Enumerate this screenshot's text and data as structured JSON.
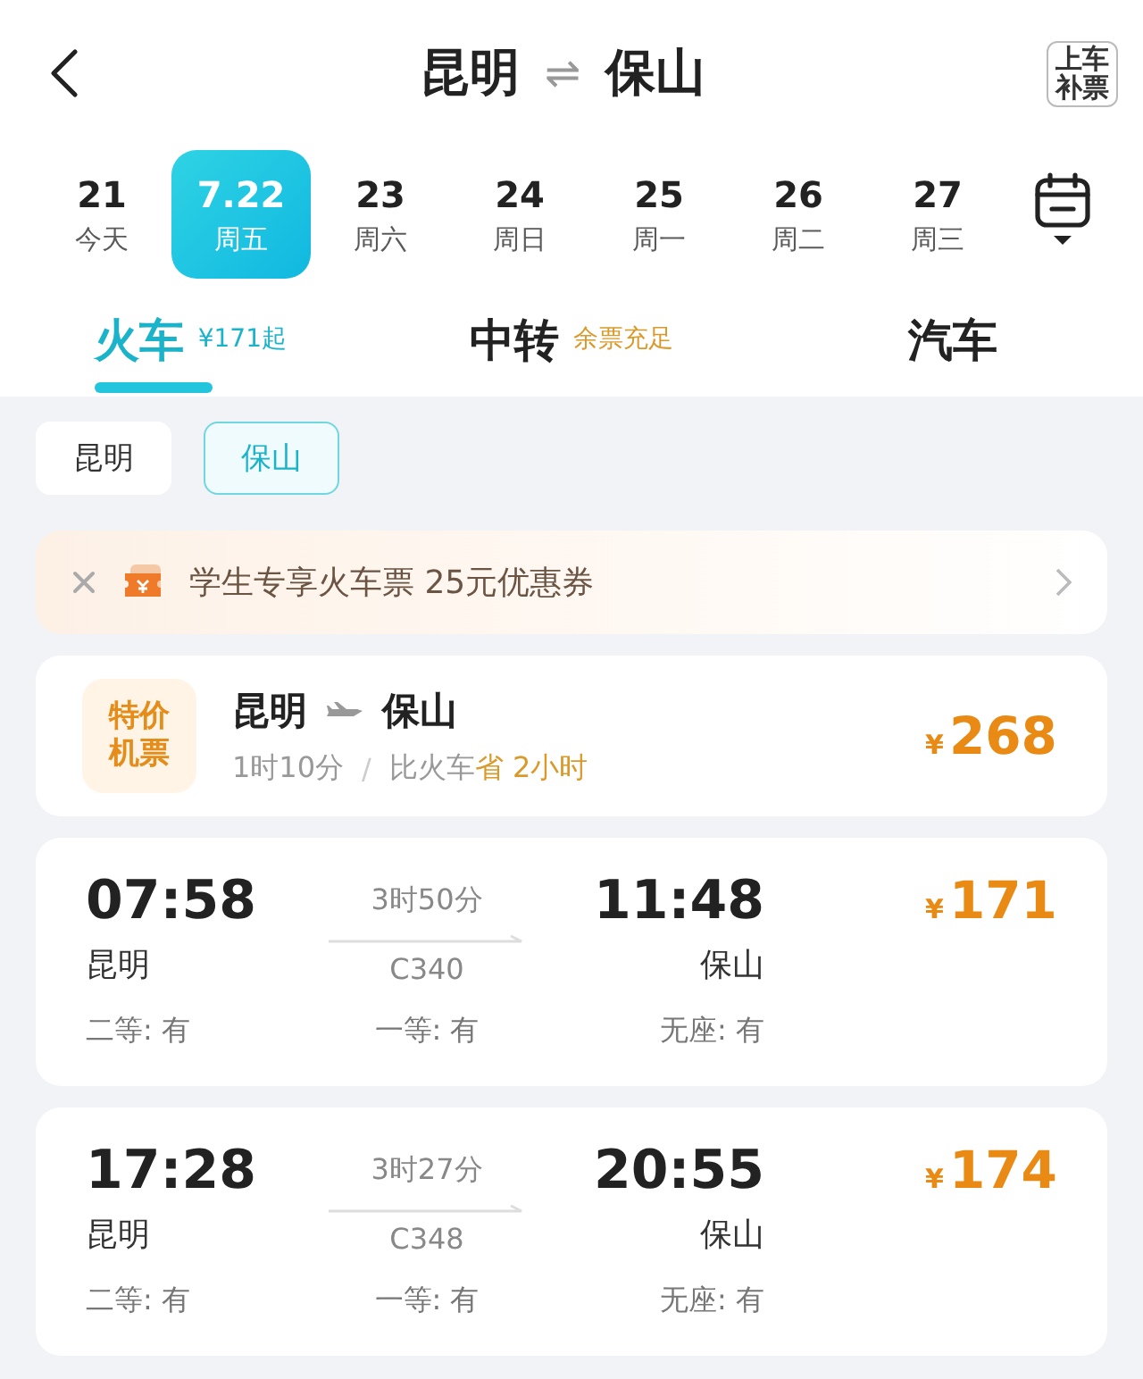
{
  "header": {
    "from": "昆明",
    "to": "保山",
    "swap_icon": "⇌",
    "badge_top": "上车",
    "badge_bottom": "补票"
  },
  "dates": [
    {
      "day": "21",
      "weekday": "今天",
      "selected": false
    },
    {
      "day": "7.22",
      "weekday": "周五",
      "selected": true
    },
    {
      "day": "23",
      "weekday": "周六",
      "selected": false
    },
    {
      "day": "24",
      "weekday": "周日",
      "selected": false
    },
    {
      "day": "25",
      "weekday": "周一",
      "selected": false
    },
    {
      "day": "26",
      "weekday": "周二",
      "selected": false
    },
    {
      "day": "27",
      "weekday": "周三",
      "selected": false
    }
  ],
  "tabs": [
    {
      "label": "火车",
      "note": "¥171起",
      "selected": true
    },
    {
      "label": "中转",
      "note": "余票充足",
      "selected": false
    },
    {
      "label": "汽车",
      "selected": false
    }
  ],
  "station_filters": [
    {
      "label": "昆明",
      "selected": false
    },
    {
      "label": "保山",
      "selected": true
    }
  ],
  "promo": {
    "text": "学生专享火车票 25元优惠券"
  },
  "flight": {
    "tag_top": "特价",
    "tag_bottom": "机票",
    "from": "昆明",
    "to": "保山",
    "duration": "1时10分",
    "separator": "/",
    "compare": "比火车",
    "saving": "省 2小时",
    "currency": "¥",
    "amount": "268"
  },
  "trains": [
    {
      "depart": "07:58",
      "depart_station": "昆明",
      "duration": "3时50分",
      "number": "C340",
      "arrive": "11:48",
      "arrive_station": "保山",
      "currency": "¥",
      "amount": "171",
      "seats": [
        "二等: 有",
        "一等: 有",
        "无座: 有"
      ]
    },
    {
      "depart": "17:28",
      "depart_station": "昆明",
      "duration": "3时27分",
      "number": "C348",
      "arrive": "20:55",
      "arrive_station": "保山",
      "currency": "¥",
      "amount": "174",
      "seats": [
        "二等: 有",
        "一等: 有",
        "无座: 有"
      ]
    }
  ]
}
